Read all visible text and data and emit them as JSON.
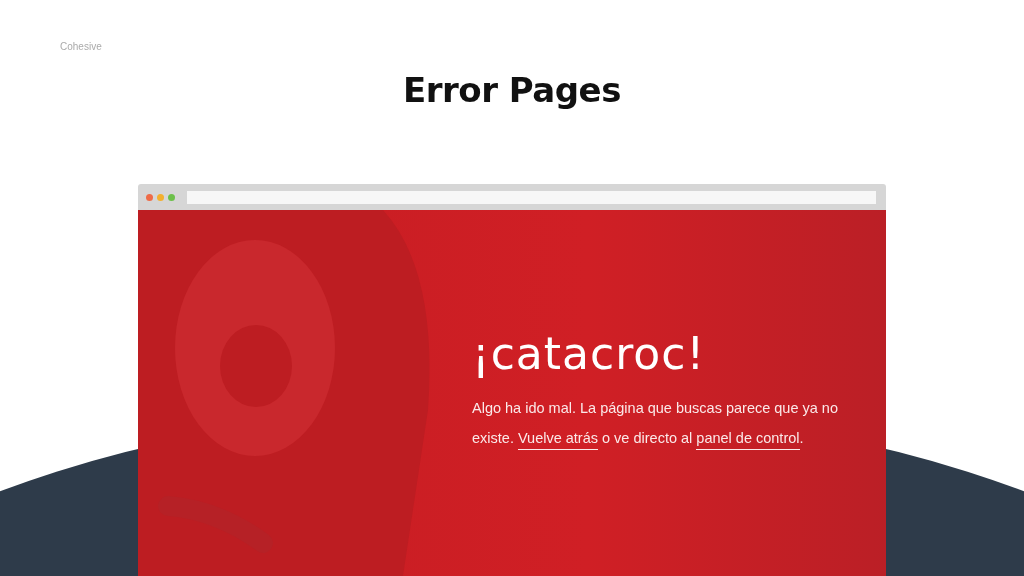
{
  "slide": {
    "brand": "Cohesive",
    "title": "Error Pages"
  },
  "browser": {
    "dots": [
      {
        "color": "#ef6b47"
      },
      {
        "color": "#f3b02f"
      },
      {
        "color": "#6cc04a"
      }
    ]
  },
  "error_page": {
    "heading": "¡catacroc!",
    "message": [
      {
        "kind": "text",
        "text": "Algo ha ido mal. La página que buscas parece que ya no existe. "
      },
      {
        "kind": "link",
        "text": "Vuelve atrás"
      },
      {
        "kind": "text",
        "text": " o ve directo al "
      },
      {
        "kind": "link",
        "text": "panel de control"
      },
      {
        "kind": "text",
        "text": "."
      }
    ]
  }
}
